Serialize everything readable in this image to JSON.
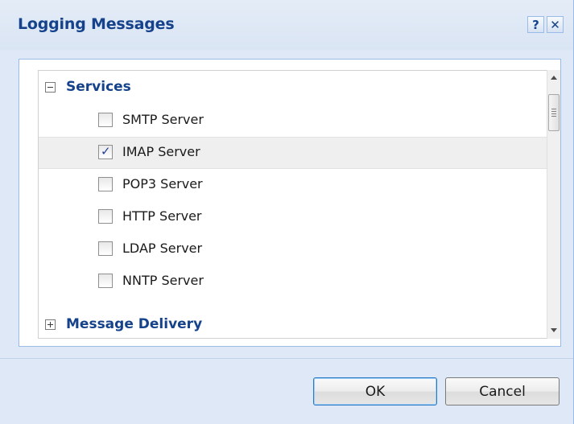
{
  "dialog": {
    "title": "Logging Messages",
    "help_glyph": "?",
    "close_glyph": "✕"
  },
  "tree": {
    "groups": [
      {
        "label": "Services",
        "expanded": true,
        "icon": "collapse-icon",
        "items": [
          {
            "label": "SMTP Server",
            "checked": false
          },
          {
            "label": "IMAP Server",
            "checked": true,
            "selected": true
          },
          {
            "label": "POP3 Server",
            "checked": false
          },
          {
            "label": "HTTP Server",
            "checked": false
          },
          {
            "label": "LDAP Server",
            "checked": false
          },
          {
            "label": "NNTP Server",
            "checked": false
          }
        ]
      },
      {
        "label": "Message Delivery",
        "expanded": false,
        "icon": "expand-icon"
      }
    ],
    "check_glyph": "✓"
  },
  "buttons": {
    "ok": "OK",
    "cancel": "Cancel"
  },
  "colors": {
    "title": "#15428b",
    "dialog_bg": "#dfe8f6",
    "selected_row": "#efefef"
  }
}
